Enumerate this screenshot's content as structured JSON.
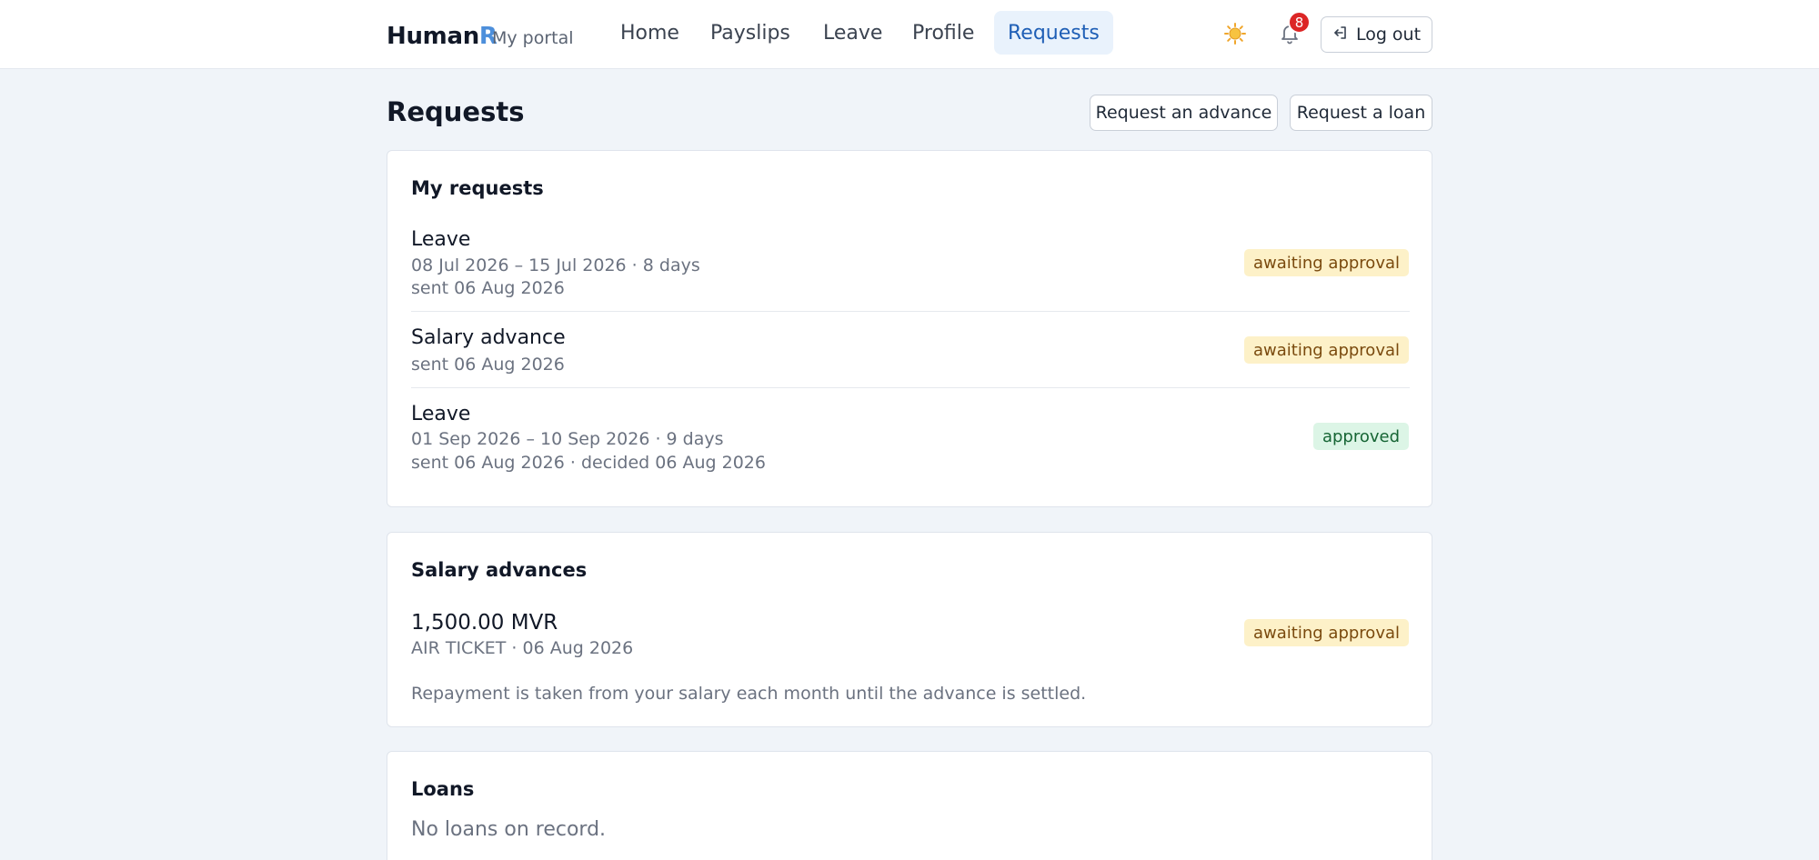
{
  "header": {
    "brand_main": "Human",
    "brand_accent": "R",
    "portal_label": "My portal",
    "nav": [
      "Home",
      "Payslips",
      "Leave",
      "Profile",
      "Requests"
    ],
    "active_nav": "Requests",
    "theme_icon": "sun-icon",
    "bell_icon": "bell-icon",
    "notification_count": "8",
    "logout_label": "Log out",
    "logout_icon": "logout-icon"
  },
  "page": {
    "title": "Requests",
    "request_advance_label": "Request an advance",
    "request_loan_label": "Request a loan"
  },
  "my_requests": {
    "title": "My requests",
    "items": [
      {
        "type": "Leave",
        "period": "08 Jul 2026 – 15 Jul 2026 · 8 days",
        "sent": "sent 06 Aug 2026",
        "status": "awaiting approval"
      },
      {
        "type": "Salary advance",
        "sent": "sent 06 Aug 2026",
        "status": "awaiting approval"
      },
      {
        "type": "Leave",
        "period": "01 Sep 2026 – 10 Sep 2026 · 9 days",
        "sent": "sent 06 Aug 2026 · decided 06 Aug 2026",
        "status": "approved"
      }
    ]
  },
  "salary_advances": {
    "title": "Salary advances",
    "items": [
      {
        "amount": "1,500.00 MVR",
        "detail": "AIR TICKET · 06 Aug 2026",
        "status": "awaiting approval"
      }
    ],
    "note": "Repayment is taken from your salary each month until the advance is settled."
  },
  "loans": {
    "title": "Loans",
    "empty_text": "No loans on record."
  },
  "colors": {
    "accent": "#1f5fb6",
    "pending_bg": "#fdf1c8",
    "approved_bg": "#dcf5e6",
    "notification": "#dc2626"
  }
}
